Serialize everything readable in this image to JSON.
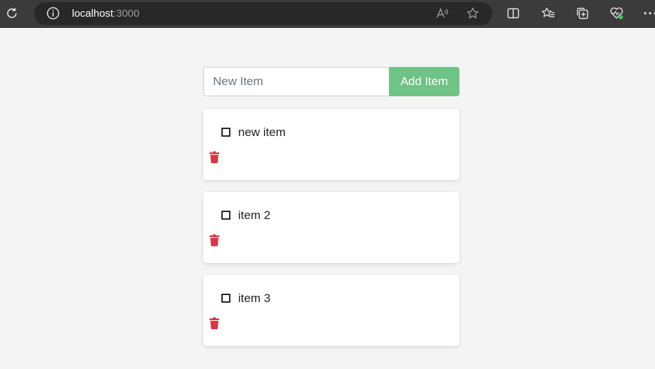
{
  "browser": {
    "url_host": "localhost",
    "url_port": ":3000"
  },
  "form": {
    "placeholder": "New Item",
    "add_label": "Add Item"
  },
  "items": [
    {
      "label": "new item",
      "checked": false
    },
    {
      "label": "item 2",
      "checked": false
    },
    {
      "label": "item 3",
      "checked": false
    }
  ],
  "colors": {
    "accent": "#6fc386",
    "delete": "#dc3545",
    "background": "#f4f4f4"
  },
  "icons": [
    "reload-icon",
    "info-icon",
    "read-aloud-icon",
    "favorite-star-icon",
    "split-screen-icon",
    "favorites-icon",
    "collections-icon",
    "browser-essentials-icon",
    "more-icon",
    "trash-icon"
  ]
}
